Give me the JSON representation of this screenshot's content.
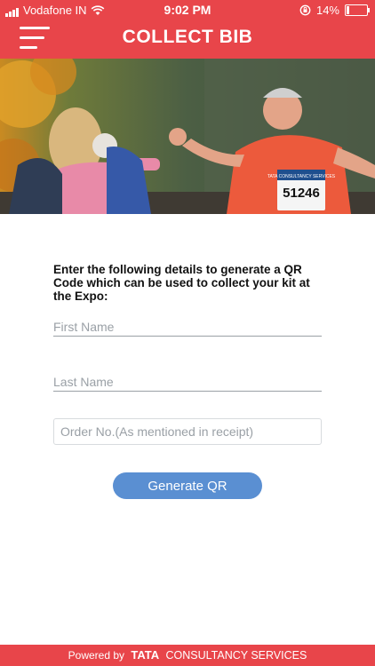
{
  "status_bar": {
    "carrier": "Vodafone IN",
    "time": "9:02 PM",
    "battery_percent": "14%",
    "battery_level": 0.14
  },
  "header": {
    "title": "COLLECT BIB",
    "menu_icon": "hamburger-menu-icon"
  },
  "hero": {
    "bib_number": "51246",
    "bib_sponsor": "TATA CONSULTANCY SERVICES"
  },
  "form": {
    "instructions": "Enter the following details to generate a QR Code which can be used to collect your kit at the Expo:",
    "first_name_placeholder": "First Name",
    "last_name_placeholder": "Last Name",
    "order_placeholder": "Order No.(As mentioned in receipt)",
    "submit_label": "Generate QR"
  },
  "footer": {
    "powered_by": "Powered by",
    "brand": "TATA",
    "brand_sub": "CONSULTANCY SERVICES"
  },
  "colors": {
    "brand_red": "#e8454a",
    "button_blue": "#5a8fd2",
    "input_line": "#9aa0a6"
  }
}
